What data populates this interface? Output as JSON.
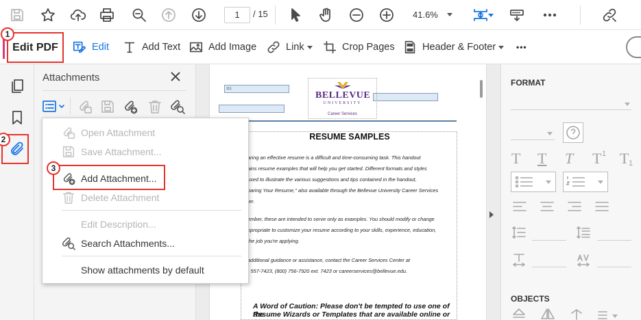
{
  "toolbar": {
    "current_page": "1",
    "page_total": "/ 15",
    "zoom": "41.6%"
  },
  "editbar": {
    "edit_pdf": "Edit PDF",
    "edit": "Edit",
    "add_text": "Add Text",
    "add_image": "Add Image",
    "link": "Link",
    "crop_pages": "Crop Pages",
    "header_footer": "Header & Footer",
    "more": "•••"
  },
  "badges": {
    "one": "1",
    "two": "2",
    "three": "3"
  },
  "attachments": {
    "title": "Attachments"
  },
  "context_menu": {
    "items": [
      {
        "label": "Open Attachment",
        "enabled": false
      },
      {
        "label": "Save Attachment...",
        "enabled": false
      },
      {
        "label": "Add Attachment...",
        "enabled": true
      },
      {
        "label": "Delete Attachment",
        "enabled": false
      },
      {
        "label": "Edit Description...",
        "enabled": false
      },
      {
        "label": "Search Attachments...",
        "enabled": true
      },
      {
        "label": "Show attachments by default",
        "enabled": true
      }
    ]
  },
  "document": {
    "field_text": "111",
    "logo_name": "BELLEVUE",
    "logo_sub": "UNIVERSITY",
    "logo_cs": "Career Services",
    "title": "RESUME SAMPLES",
    "p1": [
      "aring an effective resume is a difficult and time-consuming task.  This handout",
      "ains resume examples that will help you get started.  Different formats and styles",
      "used to illustrate the various suggestions and tips contained in the handout,",
      "paring Your Resume,\" also available through the Bellevue University Career Services",
      "ter."
    ],
    "p2": [
      "ember, these are intended to serve only as examples.  You should modify or change",
      "ppropriate to customize your resume according to your skills, experience, education,",
      "the job you're applying."
    ],
    "p3": [
      "additional guidance or assistance, contact the Career Services Center at",
      ") 557-7423, (800) 756-7920 ext. 7423 or careerservices@bellevue.edu."
    ],
    "caution": [
      "A Word of Caution: Please don't be tempted to use one of the",
      "Resume Wizards or Templates that are available online or"
    ]
  },
  "right_panel": {
    "format": "FORMAT",
    "objects": "OBJECTS",
    "text_glyph": "T"
  },
  "colors": {
    "accent_blue": "#1473e6",
    "highlight_red": "#e5322d",
    "logo_purple": "#5b2c83"
  }
}
